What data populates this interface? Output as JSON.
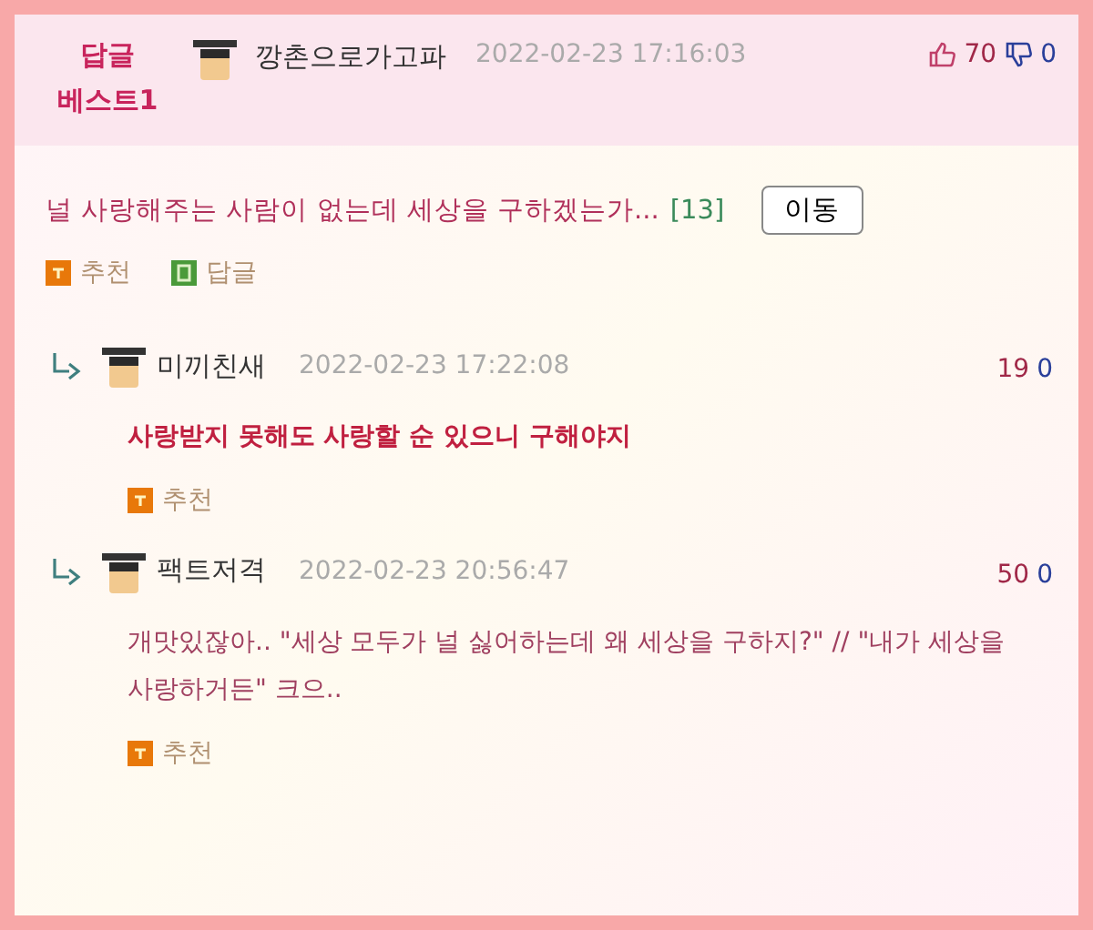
{
  "best_comment": {
    "badge": [
      "답글",
      "베스트1"
    ],
    "author": "깡촌으로가고파",
    "date": "2022-02-23 17:16:03",
    "up": "70",
    "down": "0",
    "title": "널 사랑해주는 사람이 없는데 세상을 구하겠는가...",
    "reply_count": "[13]",
    "move_button": "이동",
    "actions": [
      {
        "kind": "recommend",
        "label": "추천"
      },
      {
        "kind": "reply",
        "label": "답글"
      }
    ]
  },
  "replies": [
    {
      "author": "미끼친새",
      "date": "2022-02-23 17:22:08",
      "up": "19",
      "down": "0",
      "text": "사랑받지 못해도 사랑할 순 있으니 구해야지",
      "bold": true,
      "action": "추천"
    },
    {
      "author": "팩트저격",
      "date": "2022-02-23 20:56:47",
      "up": "50",
      "down": "0",
      "text": "개맛있잖아.. \"세상 모두가 널 싫어하는데 왜 세상을 구하지?\" // \"내가 세상을 사랑하거든\" 크으..",
      "bold": false,
      "action": "추천"
    }
  ]
}
